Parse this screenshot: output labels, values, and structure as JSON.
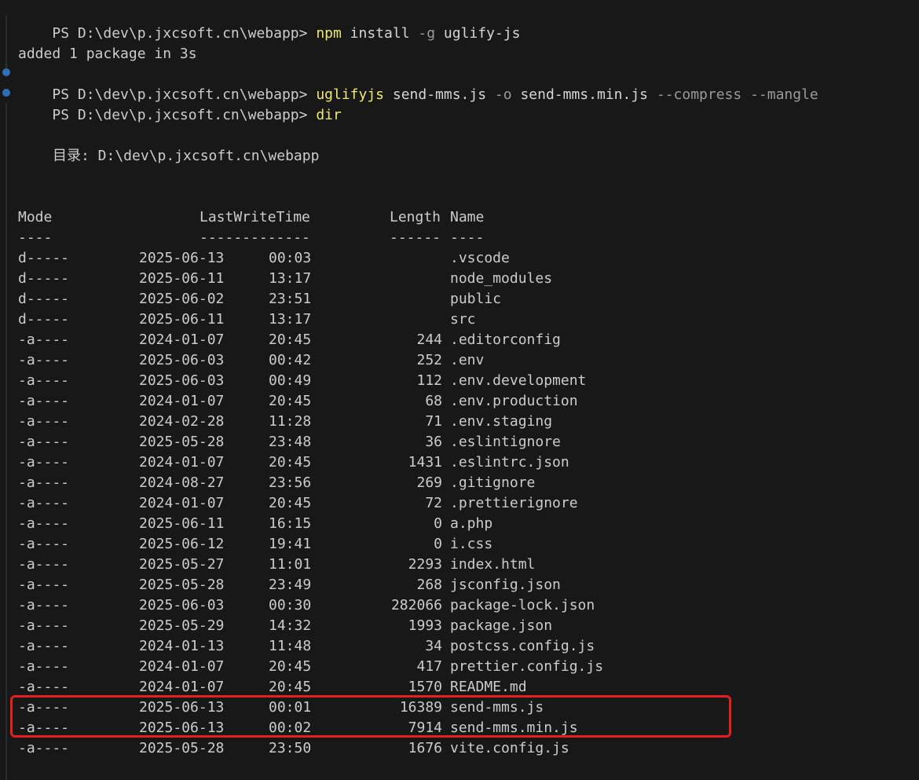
{
  "prompt": "PS D:\\dev\\p.jxcsoft.cn\\webapp>",
  "commands": [
    {
      "program": "npm",
      "args": "install",
      "params": "-g",
      "rest": "uglify-js"
    },
    {
      "program": "uglifyjs",
      "args": "send-mms.js",
      "params": "-o",
      "rest": "send-mms.min.js",
      "flags": "--compress --mangle"
    },
    {
      "program": "dir"
    }
  ],
  "npm_output": "added 1 package in 3s",
  "directory_label": "目录: D:\\dev\\p.jxcsoft.cn\\webapp",
  "table": {
    "headers": {
      "mode": "Mode",
      "time": "LastWriteTime",
      "length": "Length",
      "name": "Name"
    },
    "underlines": {
      "mode": "----",
      "time": "-------------",
      "length": "------",
      "name": "----"
    },
    "rows": [
      {
        "mode": "d-----",
        "date": "2025-06-13",
        "time": "00:03",
        "length": "",
        "name": ".vscode"
      },
      {
        "mode": "d-----",
        "date": "2025-06-11",
        "time": "13:17",
        "length": "",
        "name": "node_modules"
      },
      {
        "mode": "d-----",
        "date": "2025-06-02",
        "time": "23:51",
        "length": "",
        "name": "public"
      },
      {
        "mode": "d-----",
        "date": "2025-06-11",
        "time": "13:17",
        "length": "",
        "name": "src"
      },
      {
        "mode": "-a----",
        "date": "2024-01-07",
        "time": "20:45",
        "length": "244",
        "name": ".editorconfig"
      },
      {
        "mode": "-a----",
        "date": "2025-06-03",
        "time": "00:42",
        "length": "252",
        "name": ".env"
      },
      {
        "mode": "-a----",
        "date": "2025-06-03",
        "time": "00:49",
        "length": "112",
        "name": ".env.development"
      },
      {
        "mode": "-a----",
        "date": "2024-01-07",
        "time": "20:45",
        "length": "68",
        "name": ".env.production"
      },
      {
        "mode": "-a----",
        "date": "2024-02-28",
        "time": "11:28",
        "length": "71",
        "name": ".env.staging"
      },
      {
        "mode": "-a----",
        "date": "2025-05-28",
        "time": "23:48",
        "length": "36",
        "name": ".eslintignore"
      },
      {
        "mode": "-a----",
        "date": "2024-01-07",
        "time": "20:45",
        "length": "1431",
        "name": ".eslintrc.json"
      },
      {
        "mode": "-a----",
        "date": "2024-08-27",
        "time": "23:56",
        "length": "269",
        "name": ".gitignore"
      },
      {
        "mode": "-a----",
        "date": "2024-01-07",
        "time": "20:45",
        "length": "72",
        "name": ".prettierignore"
      },
      {
        "mode": "-a----",
        "date": "2025-06-11",
        "time": "16:15",
        "length": "0",
        "name": "a.php"
      },
      {
        "mode": "-a----",
        "date": "2025-06-12",
        "time": "19:41",
        "length": "0",
        "name": "i.css"
      },
      {
        "mode": "-a----",
        "date": "2025-05-27",
        "time": "11:01",
        "length": "2293",
        "name": "index.html"
      },
      {
        "mode": "-a----",
        "date": "2025-05-28",
        "time": "23:49",
        "length": "268",
        "name": "jsconfig.json"
      },
      {
        "mode": "-a----",
        "date": "2025-06-03",
        "time": "00:30",
        "length": "282066",
        "name": "package-lock.json"
      },
      {
        "mode": "-a----",
        "date": "2025-05-29",
        "time": "14:32",
        "length": "1993",
        "name": "package.json"
      },
      {
        "mode": "-a----",
        "date": "2024-01-13",
        "time": "11:48",
        "length": "34",
        "name": "postcss.config.js"
      },
      {
        "mode": "-a----",
        "date": "2024-01-07",
        "time": "20:45",
        "length": "417",
        "name": "prettier.config.js"
      },
      {
        "mode": "-a----",
        "date": "2024-01-07",
        "time": "20:45",
        "length": "1570",
        "name": "README.md"
      },
      {
        "mode": "-a----",
        "date": "2025-06-13",
        "time": "00:01",
        "length": "16389",
        "name": "send-mms.js"
      },
      {
        "mode": "-a----",
        "date": "2025-06-13",
        "time": "00:02",
        "length": "7914",
        "name": "send-mms.min.js"
      },
      {
        "mode": "-a----",
        "date": "2025-05-28",
        "time": "23:50",
        "length": "1676",
        "name": "vite.config.js"
      }
    ]
  },
  "colors": {
    "background": "#181818",
    "text": "#cccccc",
    "command": "#f0e96f",
    "parameter": "#9a9a9a",
    "marker": "#2f6eb8",
    "highlight": "#e62020"
  }
}
